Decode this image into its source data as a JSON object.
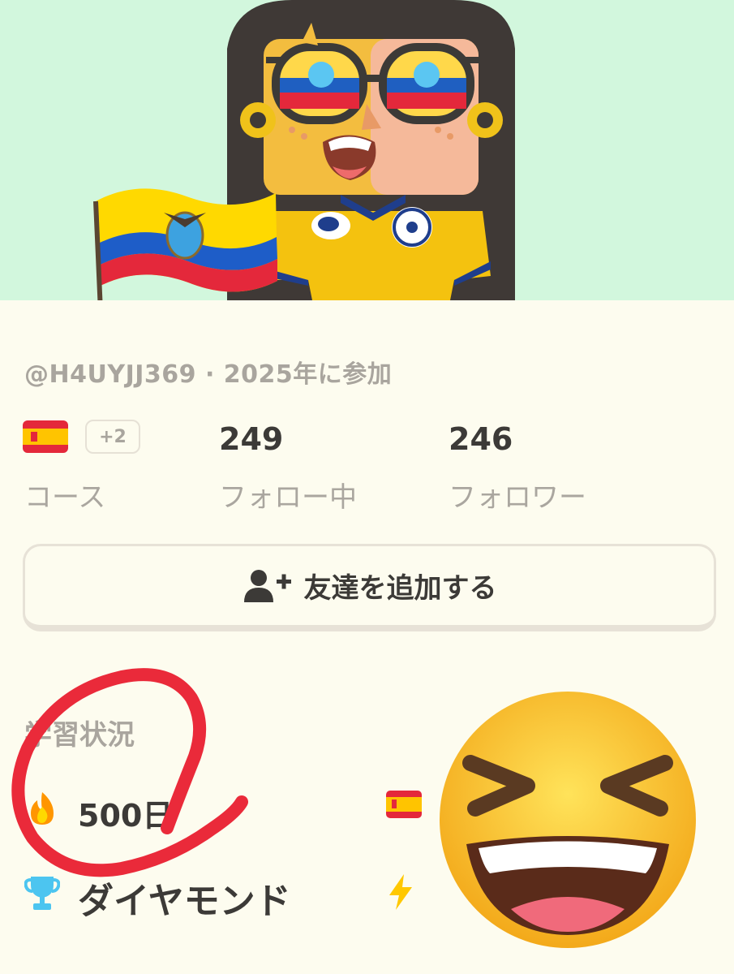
{
  "profile": {
    "username_line": "@H4UYJJ369 · 2025年に参加",
    "colors": {
      "header_bg": "#d2f7dd",
      "accent_red": "#ea2a3a",
      "text_dark": "#3c3a37",
      "text_muted": "#a9a59e"
    }
  },
  "stats": {
    "courses_extra": "+2",
    "courses_label": "コース",
    "following_count": "249",
    "following_label": "フォロー中",
    "followers_count": "246",
    "followers_label": "フォロワー"
  },
  "actions": {
    "add_friend_label": "友達を追加する",
    "add_friend_icon": "add-user-icon"
  },
  "overview": {
    "title": "学習状況",
    "streak_value": "500日",
    "streak_icon": "fire-icon",
    "league_label": "ダイヤモンド",
    "league_icon": "trophy-icon",
    "xp_icon": "lightning-bolt-icon"
  },
  "overlays": {
    "emoji_flag": "ecuador-flag-emoji",
    "emoji_face": "grinning-squinting-face-emoji"
  }
}
